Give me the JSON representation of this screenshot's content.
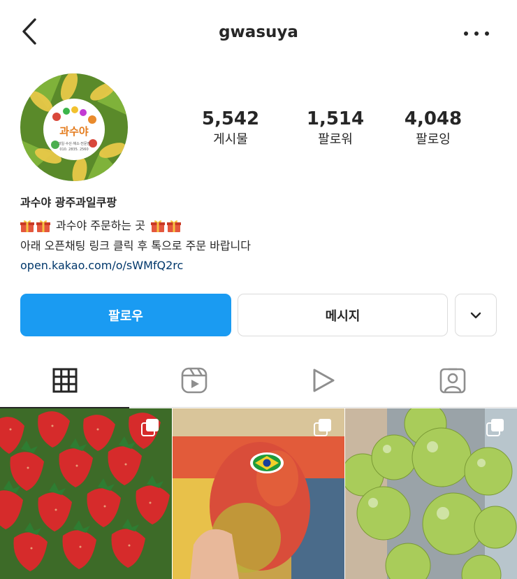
{
  "header": {
    "username": "gwasuya",
    "back_icon": "chevron-left-icon",
    "more_icon": "more-horizontal-icon"
  },
  "avatar": {
    "logo_text": "과수야",
    "logo_subtext": "과일·수산·채소·전문점",
    "logo_phone": "010. 2835. 2560"
  },
  "stats": {
    "posts": {
      "count": "5,542",
      "label": "게시물"
    },
    "followers": {
      "count": "1,514",
      "label": "팔로워"
    },
    "following": {
      "count": "4,048",
      "label": "팔로잉"
    }
  },
  "bio": {
    "name": "과수야  광주과일쿠팡",
    "line1_text": "과수야 주문하는 곳",
    "line1_icon": "gift-emoji",
    "line2": "아래 오픈채팅 링크 클릭 후 톡으로 주문 바랍니다",
    "link": "open.kakao.com/o/sWMfQ2rc"
  },
  "actions": {
    "follow_label": "팔로우",
    "message_label": "메시지",
    "dropdown_icon": "chevron-down-icon"
  },
  "tabs": [
    {
      "name": "posts-grid",
      "icon": "grid-icon",
      "active": true
    },
    {
      "name": "reels",
      "icon": "reels-icon",
      "active": false
    },
    {
      "name": "videos",
      "icon": "play-icon",
      "active": false
    },
    {
      "name": "tagged",
      "icon": "tagged-user-icon",
      "active": false
    }
  ],
  "posts": [
    {
      "subject": "strawberries",
      "icon": "multiple-photos-icon"
    },
    {
      "subject": "mango",
      "icon": "multiple-photos-icon"
    },
    {
      "subject": "green grapes",
      "icon": "multiple-photos-icon"
    }
  ],
  "colors": {
    "follow_button": "#1a9bf2",
    "link": "#00376b",
    "text": "#262626",
    "border": "#dbdbdb"
  }
}
